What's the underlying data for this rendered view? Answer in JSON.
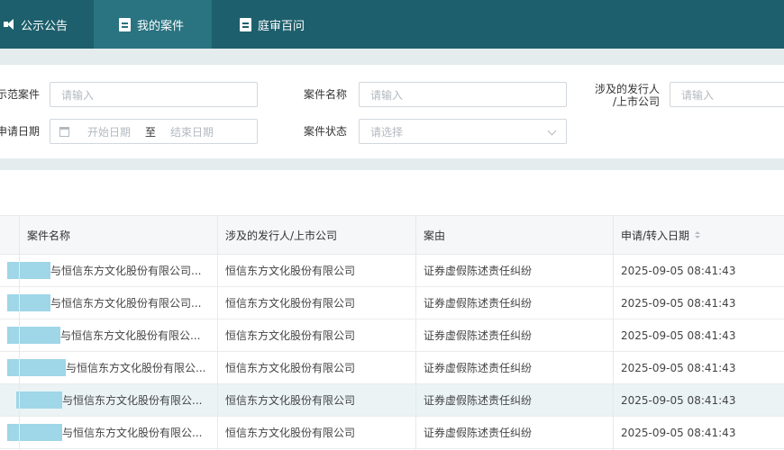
{
  "nav": {
    "tabs": [
      {
        "label": "公示公告",
        "icon": "megaphone-icon",
        "active": false
      },
      {
        "label": "我的案件",
        "icon": "document-icon",
        "active": true
      },
      {
        "label": "庭审百问",
        "icon": "document-icon",
        "active": false
      }
    ]
  },
  "filters": {
    "case_type_label": "示范案件",
    "case_type_placeholder": "请输入",
    "case_name_label": "案件名称",
    "case_name_placeholder": "请输入",
    "issuer_label_line1": "涉及的发行人",
    "issuer_label_line2": "/上市公司",
    "issuer_placeholder": "请输入",
    "date_label": "申请日期",
    "date_start_placeholder": "开始日期",
    "date_separator": "至",
    "date_end_placeholder": "结束日期",
    "status_label": "案件状态",
    "status_placeholder": "请选择"
  },
  "table": {
    "headers": [
      "案件名称",
      "涉及的发行人/上市公司",
      "案由",
      "申请/转入日期"
    ],
    "rows": [
      {
        "case_name": "与恒信东方文化股份有限公司...",
        "issuer": "恒信东方文化股份有限公司",
        "cause": "证券虚假陈述责任纠纷",
        "date": "2025-09-05 08:41:43"
      },
      {
        "case_name": "与恒信东方文化股份有限公司...",
        "issuer": "恒信东方文化股份有限公司",
        "cause": "证券虚假陈述责任纠纷",
        "date": "2025-09-05 08:41:43"
      },
      {
        "case_name": "与恒信东方文化股份有限公...",
        "issuer": "恒信东方文化股份有限公司",
        "cause": "证券虚假陈述责任纠纷",
        "date": "2025-09-05 08:41:43"
      },
      {
        "case_name": "与恒信东方文化股份有限公...",
        "issuer": "恒信东方文化股份有限公司",
        "cause": "证券虚假陈述责任纠纷",
        "date": "2025-09-05 08:41:43"
      },
      {
        "case_name": "与恒信东方文化股份有限公...",
        "issuer": "恒信东方文化股份有限公司",
        "cause": "证券虚假陈述责任纠纷",
        "date": "2025-09-05 08:41:43"
      },
      {
        "case_name": "与恒信东方文化股份有限公...",
        "issuer": "恒信东方文化股份有限公司",
        "cause": "证券虚假陈述责任纠纷",
        "date": "2025-09-05 08:41:43"
      }
    ]
  },
  "colors": {
    "nav_bg": "#1d5f6c",
    "nav_active": "#2a7381",
    "redaction": "#9fd6e8",
    "row_highlight": "#ebf3f5"
  }
}
